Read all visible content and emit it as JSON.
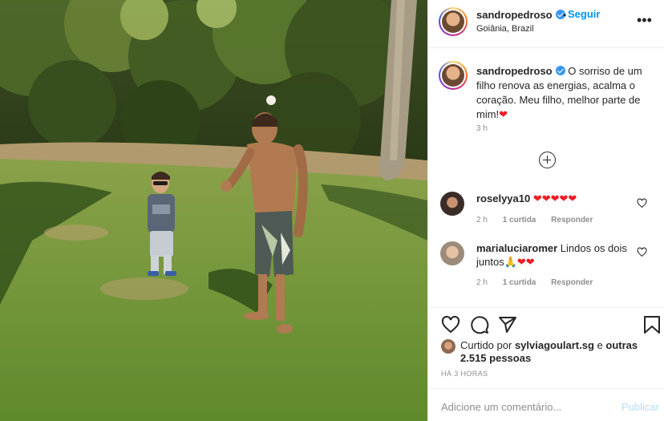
{
  "post": {
    "username": "sandropedroso",
    "follow_label": "Seguir",
    "dot": "•",
    "location": "Goiânia, Brazil",
    "more_icon": "more-options-icon"
  },
  "caption": {
    "username": "sandropedroso",
    "text": "O sorriso de um filho renova as energias, acalma o coração. Meu filho, melhor parte de mim!",
    "emoji": "❤",
    "time": "3 h"
  },
  "load_more_icon": "plus-circle-icon",
  "comments": [
    {
      "username": "roselyya10",
      "text": "❤❤❤❤❤",
      "time": "2 h",
      "likes": "1 curtida",
      "reply": "Responder"
    },
    {
      "username": "marialuciaromer",
      "text": "Lindos os dois juntos",
      "emoji": "🙏❤❤",
      "time": "2 h",
      "likes": "1 curtida",
      "reply": "Responder"
    }
  ],
  "likes": {
    "prefix": "Curtido por",
    "user": "sylviagoulart.sg",
    "and": "e",
    "others": "outras 2.515 pessoas"
  },
  "post_age": "HÁ 3 HORAS",
  "add_comment": {
    "placeholder": "Adicione um comentário...",
    "publish": "Publicar"
  },
  "colors": {
    "accent": "#0095f6",
    "heart": "#ed1c24",
    "muted": "#8e8e8e",
    "publish_disabled": "#b2dffc"
  }
}
